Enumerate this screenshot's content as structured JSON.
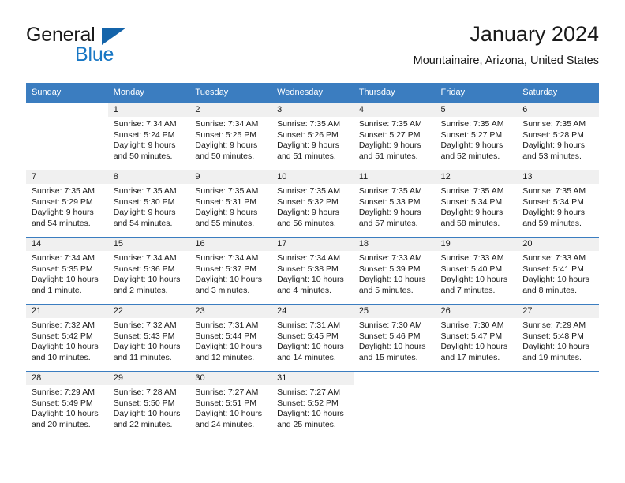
{
  "logo": {
    "word1": "General",
    "word2": "Blue",
    "triangle_color": "#1464aa",
    "blue_color": "#1877c4"
  },
  "header": {
    "title": "January 2024",
    "subtitle": "Mountainaire, Arizona, United States"
  },
  "theme": {
    "header_blue": "#3b7dc0",
    "daynum_band": "#f0f0f0"
  },
  "weekdays": [
    "Sunday",
    "Monday",
    "Tuesday",
    "Wednesday",
    "Thursday",
    "Friday",
    "Saturday"
  ],
  "weeks": [
    [
      {
        "day": "",
        "sunrise": "",
        "sunset": "",
        "daylight1": "",
        "daylight2": ""
      },
      {
        "day": "1",
        "sunrise": "Sunrise: 7:34 AM",
        "sunset": "Sunset: 5:24 PM",
        "daylight1": "Daylight: 9 hours",
        "daylight2": "and 50 minutes."
      },
      {
        "day": "2",
        "sunrise": "Sunrise: 7:34 AM",
        "sunset": "Sunset: 5:25 PM",
        "daylight1": "Daylight: 9 hours",
        "daylight2": "and 50 minutes."
      },
      {
        "day": "3",
        "sunrise": "Sunrise: 7:35 AM",
        "sunset": "Sunset: 5:26 PM",
        "daylight1": "Daylight: 9 hours",
        "daylight2": "and 51 minutes."
      },
      {
        "day": "4",
        "sunrise": "Sunrise: 7:35 AM",
        "sunset": "Sunset: 5:27 PM",
        "daylight1": "Daylight: 9 hours",
        "daylight2": "and 51 minutes."
      },
      {
        "day": "5",
        "sunrise": "Sunrise: 7:35 AM",
        "sunset": "Sunset: 5:27 PM",
        "daylight1": "Daylight: 9 hours",
        "daylight2": "and 52 minutes."
      },
      {
        "day": "6",
        "sunrise": "Sunrise: 7:35 AM",
        "sunset": "Sunset: 5:28 PM",
        "daylight1": "Daylight: 9 hours",
        "daylight2": "and 53 minutes."
      }
    ],
    [
      {
        "day": "7",
        "sunrise": "Sunrise: 7:35 AM",
        "sunset": "Sunset: 5:29 PM",
        "daylight1": "Daylight: 9 hours",
        "daylight2": "and 54 minutes."
      },
      {
        "day": "8",
        "sunrise": "Sunrise: 7:35 AM",
        "sunset": "Sunset: 5:30 PM",
        "daylight1": "Daylight: 9 hours",
        "daylight2": "and 54 minutes."
      },
      {
        "day": "9",
        "sunrise": "Sunrise: 7:35 AM",
        "sunset": "Sunset: 5:31 PM",
        "daylight1": "Daylight: 9 hours",
        "daylight2": "and 55 minutes."
      },
      {
        "day": "10",
        "sunrise": "Sunrise: 7:35 AM",
        "sunset": "Sunset: 5:32 PM",
        "daylight1": "Daylight: 9 hours",
        "daylight2": "and 56 minutes."
      },
      {
        "day": "11",
        "sunrise": "Sunrise: 7:35 AM",
        "sunset": "Sunset: 5:33 PM",
        "daylight1": "Daylight: 9 hours",
        "daylight2": "and 57 minutes."
      },
      {
        "day": "12",
        "sunrise": "Sunrise: 7:35 AM",
        "sunset": "Sunset: 5:34 PM",
        "daylight1": "Daylight: 9 hours",
        "daylight2": "and 58 minutes."
      },
      {
        "day": "13",
        "sunrise": "Sunrise: 7:35 AM",
        "sunset": "Sunset: 5:34 PM",
        "daylight1": "Daylight: 9 hours",
        "daylight2": "and 59 minutes."
      }
    ],
    [
      {
        "day": "14",
        "sunrise": "Sunrise: 7:34 AM",
        "sunset": "Sunset: 5:35 PM",
        "daylight1": "Daylight: 10 hours",
        "daylight2": "and 1 minute."
      },
      {
        "day": "15",
        "sunrise": "Sunrise: 7:34 AM",
        "sunset": "Sunset: 5:36 PM",
        "daylight1": "Daylight: 10 hours",
        "daylight2": "and 2 minutes."
      },
      {
        "day": "16",
        "sunrise": "Sunrise: 7:34 AM",
        "sunset": "Sunset: 5:37 PM",
        "daylight1": "Daylight: 10 hours",
        "daylight2": "and 3 minutes."
      },
      {
        "day": "17",
        "sunrise": "Sunrise: 7:34 AM",
        "sunset": "Sunset: 5:38 PM",
        "daylight1": "Daylight: 10 hours",
        "daylight2": "and 4 minutes."
      },
      {
        "day": "18",
        "sunrise": "Sunrise: 7:33 AM",
        "sunset": "Sunset: 5:39 PM",
        "daylight1": "Daylight: 10 hours",
        "daylight2": "and 5 minutes."
      },
      {
        "day": "19",
        "sunrise": "Sunrise: 7:33 AM",
        "sunset": "Sunset: 5:40 PM",
        "daylight1": "Daylight: 10 hours",
        "daylight2": "and 7 minutes."
      },
      {
        "day": "20",
        "sunrise": "Sunrise: 7:33 AM",
        "sunset": "Sunset: 5:41 PM",
        "daylight1": "Daylight: 10 hours",
        "daylight2": "and 8 minutes."
      }
    ],
    [
      {
        "day": "21",
        "sunrise": "Sunrise: 7:32 AM",
        "sunset": "Sunset: 5:42 PM",
        "daylight1": "Daylight: 10 hours",
        "daylight2": "and 10 minutes."
      },
      {
        "day": "22",
        "sunrise": "Sunrise: 7:32 AM",
        "sunset": "Sunset: 5:43 PM",
        "daylight1": "Daylight: 10 hours",
        "daylight2": "and 11 minutes."
      },
      {
        "day": "23",
        "sunrise": "Sunrise: 7:31 AM",
        "sunset": "Sunset: 5:44 PM",
        "daylight1": "Daylight: 10 hours",
        "daylight2": "and 12 minutes."
      },
      {
        "day": "24",
        "sunrise": "Sunrise: 7:31 AM",
        "sunset": "Sunset: 5:45 PM",
        "daylight1": "Daylight: 10 hours",
        "daylight2": "and 14 minutes."
      },
      {
        "day": "25",
        "sunrise": "Sunrise: 7:30 AM",
        "sunset": "Sunset: 5:46 PM",
        "daylight1": "Daylight: 10 hours",
        "daylight2": "and 15 minutes."
      },
      {
        "day": "26",
        "sunrise": "Sunrise: 7:30 AM",
        "sunset": "Sunset: 5:47 PM",
        "daylight1": "Daylight: 10 hours",
        "daylight2": "and 17 minutes."
      },
      {
        "day": "27",
        "sunrise": "Sunrise: 7:29 AM",
        "sunset": "Sunset: 5:48 PM",
        "daylight1": "Daylight: 10 hours",
        "daylight2": "and 19 minutes."
      }
    ],
    [
      {
        "day": "28",
        "sunrise": "Sunrise: 7:29 AM",
        "sunset": "Sunset: 5:49 PM",
        "daylight1": "Daylight: 10 hours",
        "daylight2": "and 20 minutes."
      },
      {
        "day": "29",
        "sunrise": "Sunrise: 7:28 AM",
        "sunset": "Sunset: 5:50 PM",
        "daylight1": "Daylight: 10 hours",
        "daylight2": "and 22 minutes."
      },
      {
        "day": "30",
        "sunrise": "Sunrise: 7:27 AM",
        "sunset": "Sunset: 5:51 PM",
        "daylight1": "Daylight: 10 hours",
        "daylight2": "and 24 minutes."
      },
      {
        "day": "31",
        "sunrise": "Sunrise: 7:27 AM",
        "sunset": "Sunset: 5:52 PM",
        "daylight1": "Daylight: 10 hours",
        "daylight2": "and 25 minutes."
      },
      {
        "day": "",
        "sunrise": "",
        "sunset": "",
        "daylight1": "",
        "daylight2": ""
      },
      {
        "day": "",
        "sunrise": "",
        "sunset": "",
        "daylight1": "",
        "daylight2": ""
      },
      {
        "day": "",
        "sunrise": "",
        "sunset": "",
        "daylight1": "",
        "daylight2": ""
      }
    ]
  ]
}
